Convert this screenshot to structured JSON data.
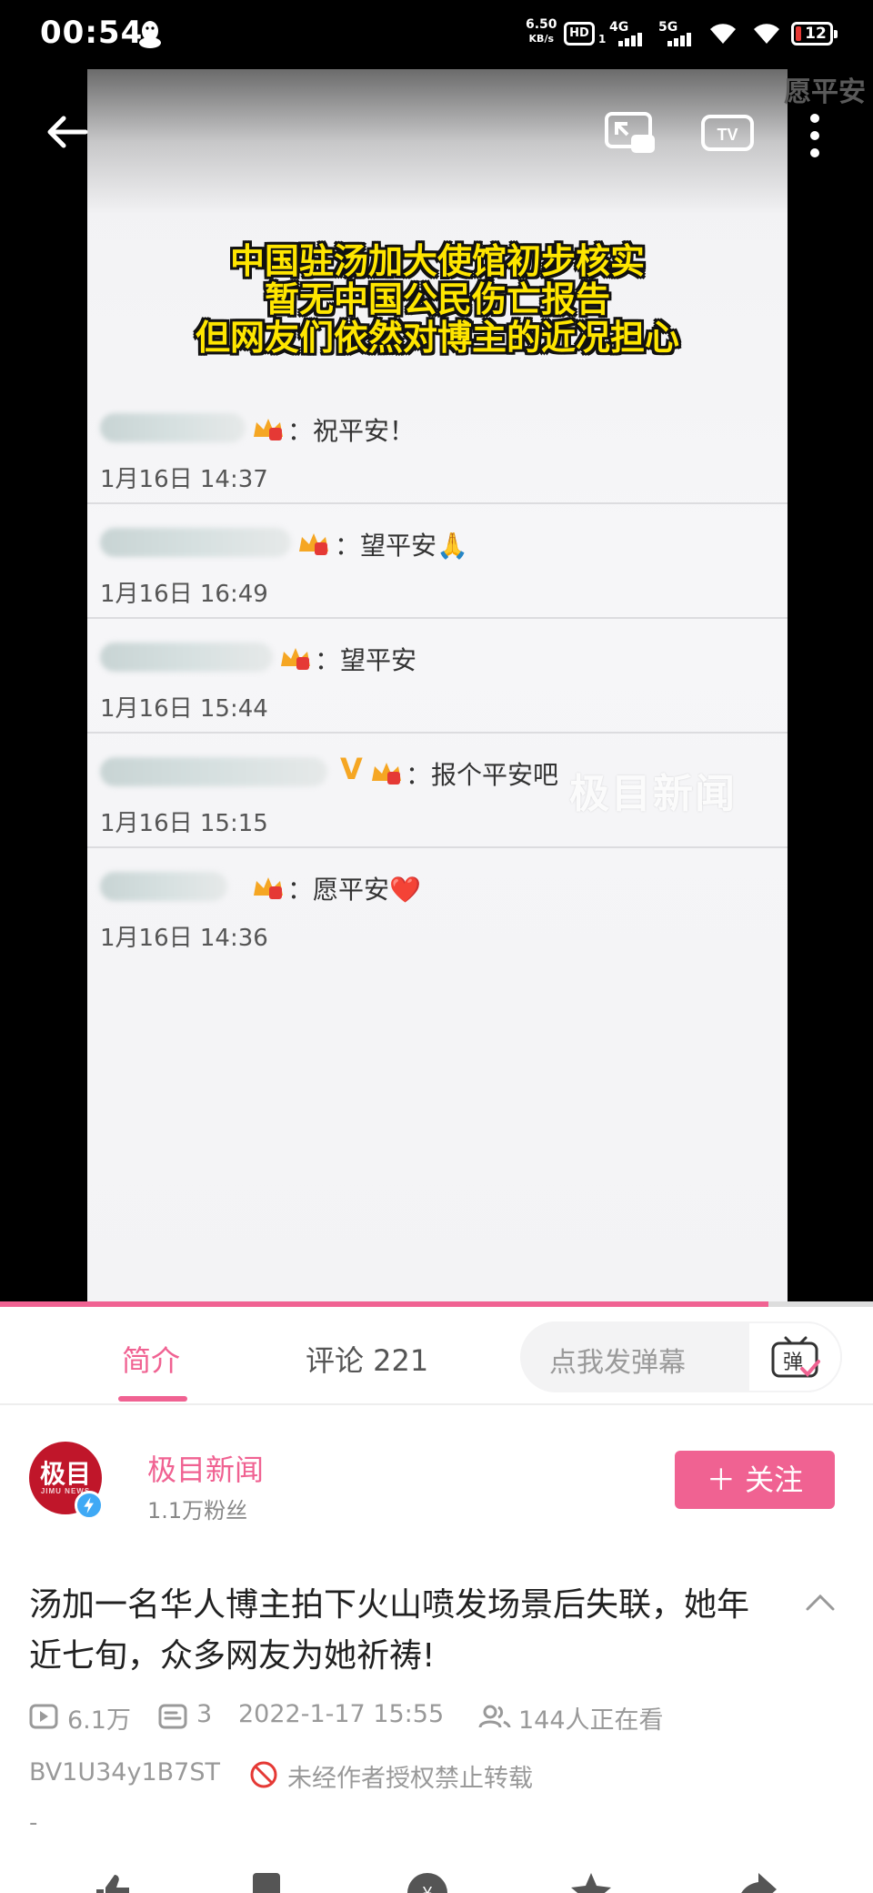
{
  "status_bar": {
    "time": "00:54",
    "net_speed_value": "6.50",
    "net_speed_unit": "KB/s",
    "hd_label": "HD",
    "hd_sub": "1",
    "sig1_label": "4G",
    "sig2_label": "5G",
    "battery": "12"
  },
  "video": {
    "overlay_title_lines": [
      "中国驻汤加大使馆初步核实",
      "暂无中国公民伤亡报告",
      "但网友们依然对博主的近况担心"
    ],
    "corner_caption": "愿平安",
    "watermark": "极目新闻",
    "screen_comments": [
      {
        "text": "：祝平安！",
        "time": "1月16日 14:37"
      },
      {
        "text": "：望平安🙏",
        "time": "1月16日 16:49"
      },
      {
        "text": "：望平安",
        "time": "1月16日 15:44"
      },
      {
        "text": "：报个平安吧",
        "time": "1月16日 15:15"
      },
      {
        "text": "：愿平安❤️",
        "time": "1月16日 14:36"
      }
    ],
    "progress": 0.88
  },
  "tabs": {
    "intro": "简介",
    "comments": "评论 221",
    "danmaku_placeholder": "点我发弹幕",
    "danmaku_btn": "弹"
  },
  "uploader": {
    "avatar_text": "极目",
    "avatar_sub": "JIMU NEWS",
    "name": "极目新闻",
    "fans": "1.1万粉丝",
    "follow": "＋ 关注"
  },
  "info": {
    "title": "汤加一名华人博主拍下火山喷发场景后失联，她年近七旬，众多网友为她祈祷!",
    "plays": "6.1万",
    "danmaku_count": "3",
    "date": "2022-1-17 15:55",
    "watching": "144人正在看",
    "bvid": "BV1U34y1B7ST",
    "copyright": "未经作者授权禁止转载",
    "dash": "-"
  },
  "colors": {
    "accent": "#f06292",
    "overlay_text": "#ffe600"
  }
}
